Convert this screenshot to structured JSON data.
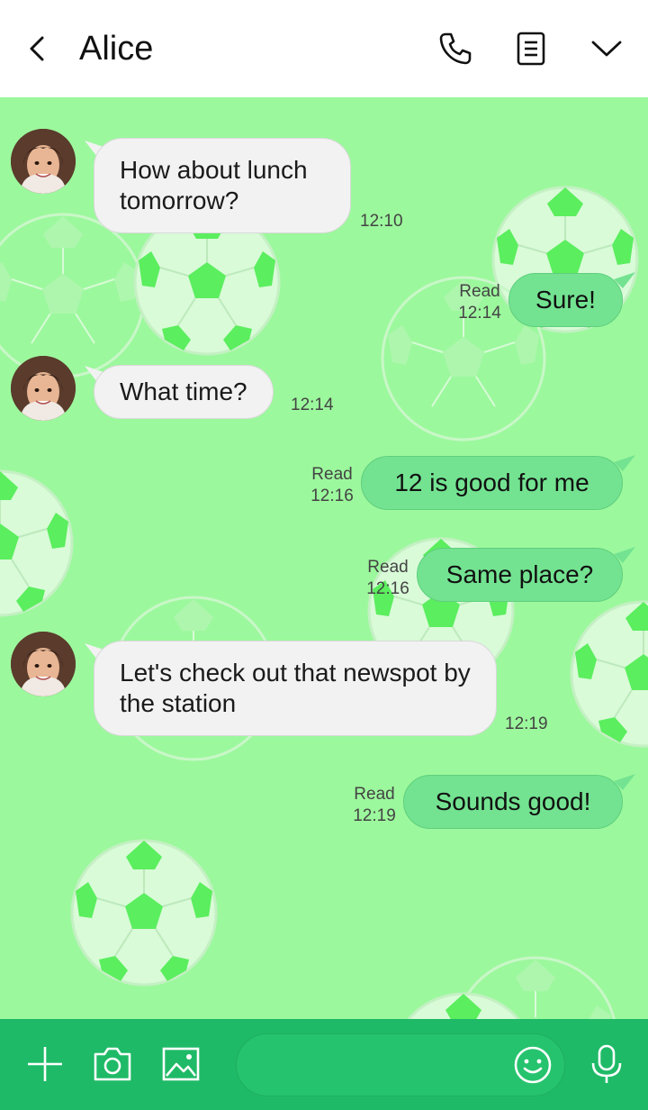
{
  "header": {
    "title": "Alice"
  },
  "messages": [
    {
      "id": "m1",
      "direction": "in",
      "text": "How about lunch tomorrow?",
      "time": "12:10"
    },
    {
      "id": "m2",
      "direction": "out",
      "text": "Sure!",
      "status": "Read",
      "time": "12:14"
    },
    {
      "id": "m3",
      "direction": "in",
      "text": "What time?",
      "time": "12:14"
    },
    {
      "id": "m4",
      "direction": "out",
      "text": "12 is good for me",
      "status": "Read",
      "time": "12:16"
    },
    {
      "id": "m5",
      "direction": "out",
      "text": "Same place?",
      "status": "Read",
      "time": "12:16"
    },
    {
      "id": "m6",
      "direction": "in",
      "text": "Let's check out that newspot by the station",
      "time": "12:19"
    },
    {
      "id": "m7",
      "direction": "out",
      "text": "Sounds good!",
      "status": "Read",
      "time": "12:19"
    }
  ],
  "composer": {
    "value": "",
    "placeholder": ""
  },
  "icons": {
    "back": "chevron-left-icon",
    "call": "phone-icon",
    "notes": "document-icon",
    "menu": "chevron-down-icon",
    "add": "plus-icon",
    "camera": "camera-icon",
    "gallery": "image-icon",
    "emoji": "smiley-icon",
    "voice": "microphone-icon"
  },
  "colors": {
    "chat_background": "#9cf89d",
    "outgoing_bubble": "#73e391",
    "incoming_bubble": "#f2f2f2",
    "bottom_bar": "#1fba67"
  }
}
